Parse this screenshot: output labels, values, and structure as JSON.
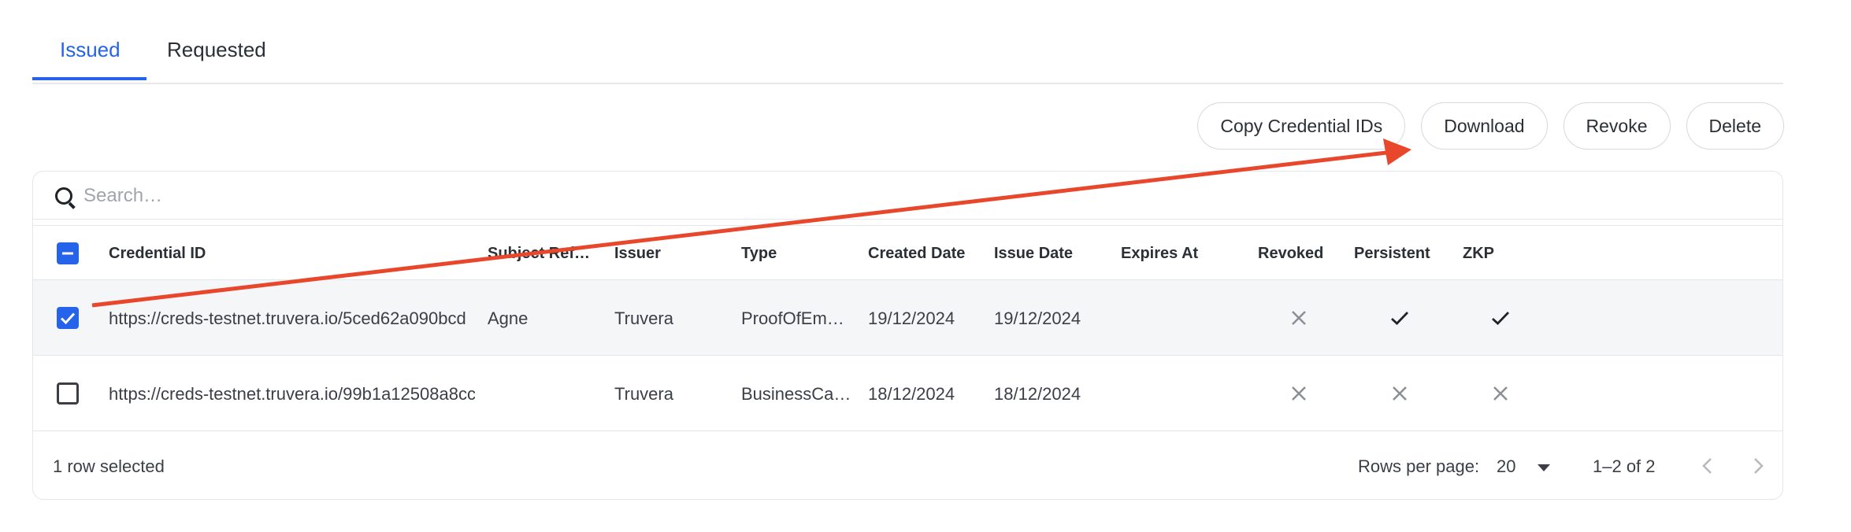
{
  "tabs": [
    {
      "label": "Issued",
      "active": true
    },
    {
      "label": "Requested",
      "active": false
    }
  ],
  "actions": {
    "copy": "Copy Credential IDs",
    "download": "Download",
    "revoke": "Revoke",
    "delete": "Delete"
  },
  "search": {
    "placeholder": "Search…",
    "value": ""
  },
  "columns": [
    "Credential ID",
    "Subject Refer…",
    "Issuer",
    "Type",
    "Created Date",
    "Issue Date",
    "Expires At",
    "Revoked",
    "Persistent",
    "ZKP"
  ],
  "rows": [
    {
      "selected": true,
      "credential_id": "https://creds-testnet.truvera.io/5ced62a090bcd",
      "subject": "Agne",
      "issuer": "Truvera",
      "type": "ProofOfEm…",
      "created": "19/12/2024",
      "issued": "19/12/2024",
      "expires": "",
      "revoked": "x-icon",
      "persistent": "check-icon",
      "zkp": "check-icon"
    },
    {
      "selected": false,
      "credential_id": "https://creds-testnet.truvera.io/99b1a12508a8cc",
      "subject": "",
      "issuer": "Truvera",
      "type": "BusinessCa…",
      "created": "18/12/2024",
      "issued": "18/12/2024",
      "expires": "",
      "revoked": "x-icon",
      "persistent": "x-icon",
      "zkp": "x-icon"
    }
  ],
  "footer": {
    "selected_text": "1 row selected",
    "rows_per_page_label": "Rows per page:",
    "rows_per_page_value": "20",
    "range": "1–2 of 2"
  },
  "colors": {
    "accent": "#2563eb",
    "annotation": "#e8472b"
  }
}
